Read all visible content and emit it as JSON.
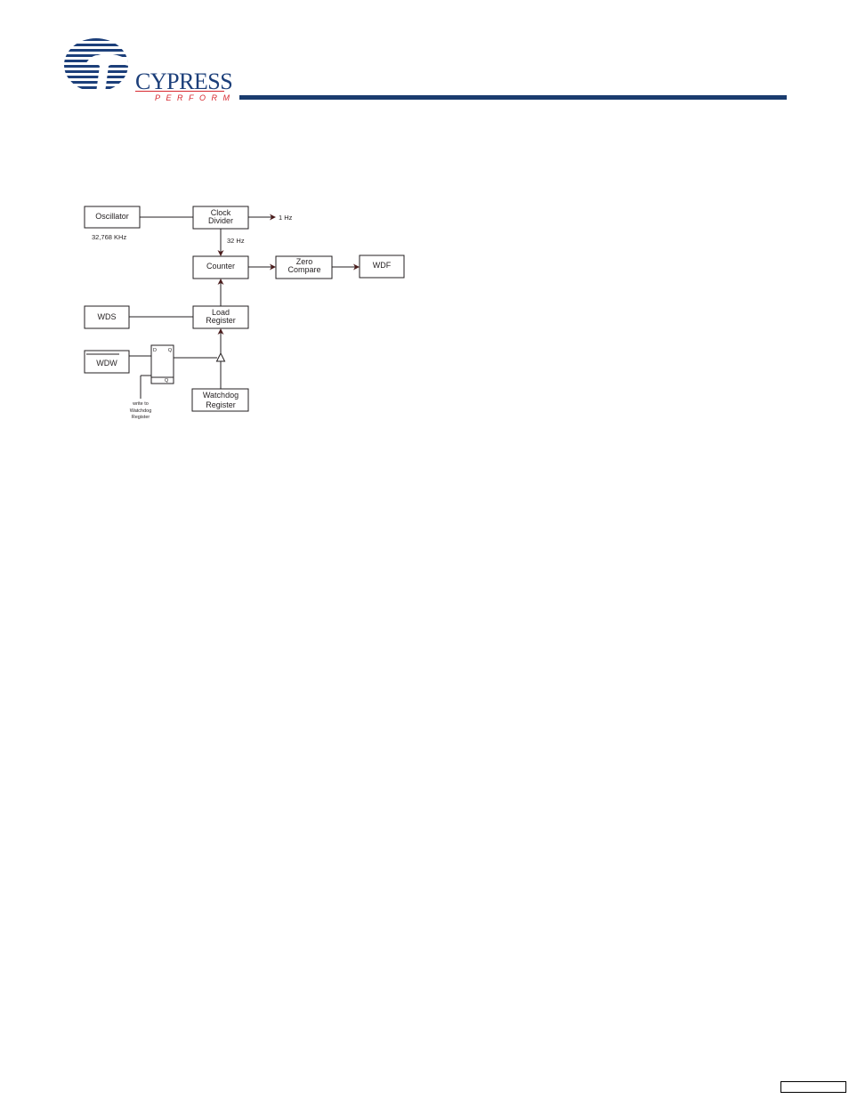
{
  "header": {
    "logo": {
      "wordmark": "CYPRESS",
      "tagline": "PERFORM",
      "brand_color": "#1c3f7a",
      "accent_color": "#d7282f"
    },
    "rule_color": "#1a3c6e"
  },
  "diagram": {
    "blocks": {
      "oscillator": "Oscillator",
      "clock_divider": [
        "Clock",
        "Divider"
      ],
      "counter": "Counter",
      "zero_compare": [
        "Zero",
        "Compare"
      ],
      "wdf": "WDF",
      "wds": "WDS",
      "load_register": [
        "Load",
        "Register"
      ],
      "wdw": "WDW",
      "watchdog_register": [
        "Watchdog",
        "Register"
      ]
    },
    "labels": {
      "osc_freq": "32,768 KHz",
      "one_hz": "1 Hz",
      "thirty_two_hz": "32 Hz",
      "write_note": [
        "write to",
        "Watchdog",
        "Register"
      ],
      "ff_d": "D",
      "ff_q": "Q",
      "ff_qbar": "Q"
    }
  },
  "footer": {
    "page_number": ""
  }
}
